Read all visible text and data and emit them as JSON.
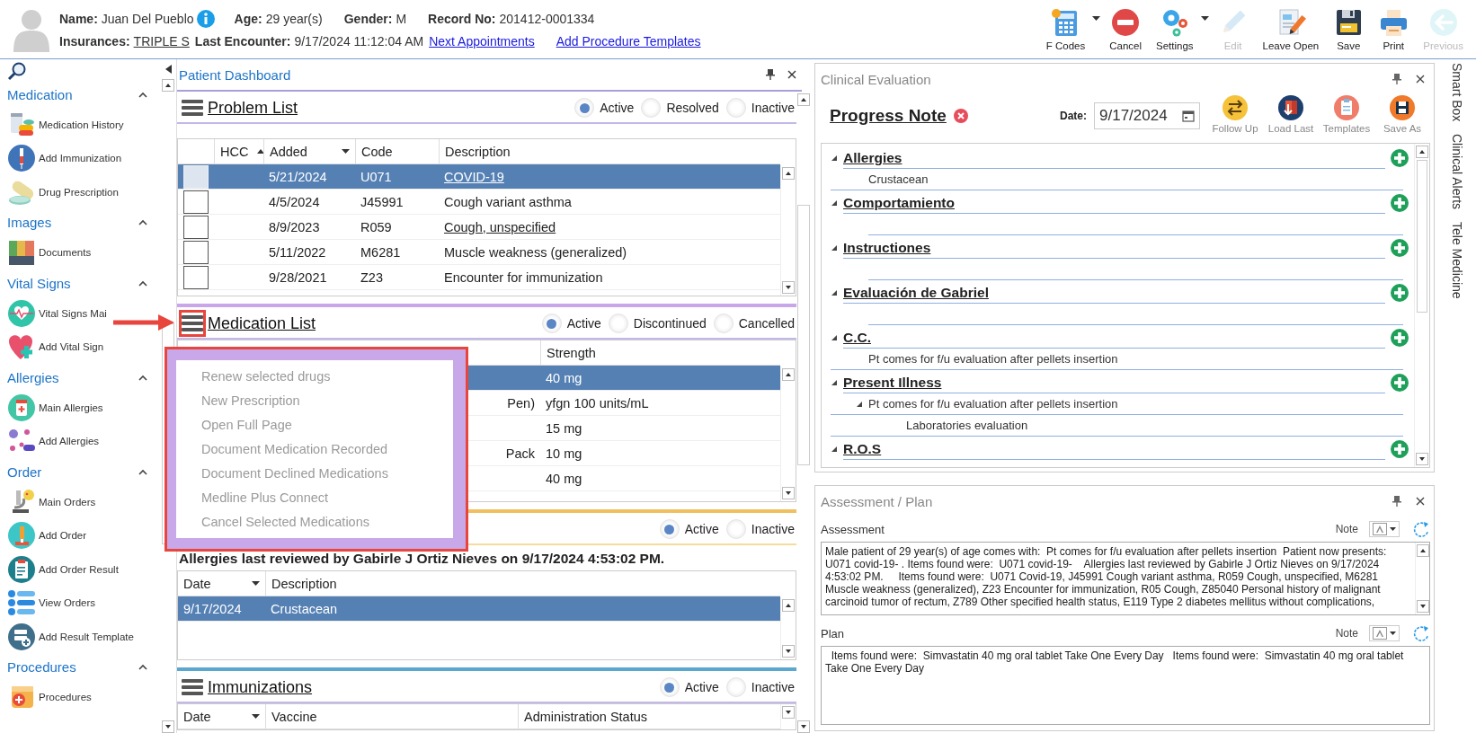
{
  "header": {
    "row_1": [
      {
        "label": "Name:",
        "value": "Juan Del Pueblo",
        "info": true,
        "link": false
      },
      {
        "label": "Age:",
        "value": "29 year(s)",
        "info": false,
        "link": false
      },
      {
        "label": "Gender:",
        "value": "M",
        "info": false,
        "link": false
      },
      {
        "label": "Record No:",
        "value": "201412-0001334",
        "info": false,
        "link": false
      }
    ],
    "row_2": [
      {
        "label": "Insurances:",
        "value": "TRIPLE S",
        "info": false,
        "link": true
      },
      {
        "label": "Last Encounter:",
        "value": "9/17/2024 11:12:04 AM",
        "info": false,
        "link": false
      }
    ],
    "links": [
      "Next Appointments",
      "Add Procedure Templates"
    ],
    "toolbar": [
      {
        "label": "F Codes",
        "dropdown": true,
        "disabled": false
      },
      {
        "label": "Cancel",
        "dropdown": false,
        "disabled": false
      },
      {
        "label": "Settings",
        "dropdown": true,
        "disabled": false
      },
      {
        "label": "Edit",
        "dropdown": false,
        "disabled": true
      },
      {
        "label": "Leave Open",
        "dropdown": false,
        "disabled": false
      },
      {
        "label": "Save",
        "dropdown": false,
        "disabled": false
      },
      {
        "label": "Print",
        "dropdown": false,
        "disabled": false
      },
      {
        "label": "Previous",
        "dropdown": false,
        "disabled": true
      }
    ]
  },
  "sidebar": {
    "groups": [
      {
        "title": "Medication",
        "expanded": true,
        "items": [
          "Medication History",
          "Add Immunization",
          "Drug Prescription"
        ]
      },
      {
        "title": "Images",
        "expanded": true,
        "items": [
          "Documents"
        ]
      },
      {
        "title": "Vital Signs",
        "expanded": true,
        "items": [
          "Vital Signs Mai",
          "Add Vital Sign"
        ]
      },
      {
        "title": "Allergies",
        "expanded": true,
        "items": [
          "Main Allergies",
          "Add Allergies"
        ]
      },
      {
        "title": "Order",
        "expanded": true,
        "items": [
          "Main Orders",
          "Add Order",
          "Add Order Result",
          "View Orders",
          "Add Result Template"
        ]
      },
      {
        "title": "Procedures",
        "expanded": true,
        "items": [
          "Procedures"
        ]
      }
    ]
  },
  "dashboard": {
    "title": "Patient Dashboard",
    "sections": [
      {
        "kind": "problems",
        "title": "Problem List",
        "highlighted": false,
        "filters": [
          {
            "label": "Active",
            "selected": true
          },
          {
            "label": "Resolved",
            "selected": false
          },
          {
            "label": "Inactive",
            "selected": false
          }
        ],
        "table": {
          "columns": [
            "HCC",
            "Added",
            "Code",
            "Description"
          ],
          "rows": [
            {
              "added": "5/21/2024",
              "code": "U071",
              "description": "COVID-19",
              "link": true,
              "checked": false,
              "selected": true
            },
            {
              "added": "4/5/2024",
              "code": "J45991",
              "description": "Cough variant asthma",
              "link": false,
              "checked": false,
              "selected": false
            },
            {
              "added": "8/9/2023",
              "code": "R059",
              "description": "Cough, unspecified",
              "link": true,
              "checked": false,
              "selected": false
            },
            {
              "added": "5/11/2022",
              "code": "M6281",
              "description": "Muscle weakness (generalized)",
              "link": false,
              "checked": false,
              "selected": false
            },
            {
              "added": "9/28/2021",
              "code": "Z23",
              "description": "Encounter for immunization",
              "link": false,
              "checked": false,
              "selected": false
            }
          ]
        }
      },
      {
        "kind": "medications",
        "title": "Medication List",
        "highlighted": true,
        "filters": [
          {
            "label": "Active",
            "selected": true
          },
          {
            "label": "Discontinued",
            "selected": false
          },
          {
            "label": "Cancelled",
            "selected": false
          }
        ],
        "table": {
          "columns": [
            "Strength"
          ],
          "rows": [
            {
              "strength": "40 mg",
              "selected": true
            },
            {
              "name": "Pen)",
              "strength": "yfgn 100 units/mL",
              "selected": false
            },
            {
              "strength": "15 mg",
              "selected": false
            },
            {
              "name": "Pack",
              "strength": "10 mg",
              "selected": false
            },
            {
              "strength": "40 mg",
              "selected": false
            }
          ]
        },
        "menu": [
          {
            "label": "Renew selected drugs",
            "disabled": true
          },
          {
            "label": "New Prescription",
            "disabled": true
          },
          {
            "label": "Open Full Page",
            "disabled": true
          },
          {
            "label": "Document Medication Recorded",
            "disabled": true
          },
          {
            "label": "Document Declined Medications",
            "disabled": true
          },
          {
            "label": "Medline Plus Connect",
            "disabled": true
          },
          {
            "label": "Cancel Selected Medications",
            "disabled": true
          }
        ]
      },
      {
        "kind": "allergies",
        "filters": [
          {
            "label": "Active",
            "selected": true
          },
          {
            "label": "Inactive",
            "selected": false
          }
        ],
        "note": "Allergies last reviewed by Gabirle J Ortiz Nieves on 9/17/2024 4:53:02 PM.",
        "table": {
          "columns": [
            "Date",
            "Description"
          ],
          "rows": [
            {
              "date": "9/17/2024",
              "description": "Crustacean",
              "selected": true
            }
          ]
        }
      },
      {
        "kind": "immunizations",
        "title": "Immunizations",
        "highlighted": false,
        "filters": [
          {
            "label": "Active",
            "selected": true
          },
          {
            "label": "Inactive",
            "selected": false
          }
        ],
        "table": {
          "columns": [
            "Date",
            "Vaccine",
            "Administration Status"
          ]
        }
      }
    ]
  },
  "clinical_evaluation": {
    "title": "Clinical Evaluation",
    "note_title": "Progress Note",
    "date_label": "Date:",
    "date": "9/17/2024",
    "actions": [
      "Follow Up",
      "Load Last",
      "Templates",
      "Save As"
    ],
    "sections": [
      {
        "title": "Allergies",
        "expanded": true,
        "children": [
          {
            "text": "Crustacean"
          }
        ]
      },
      {
        "title": "Comportamiento",
        "expanded": true
      },
      {
        "title": "Instructiones",
        "expanded": true
      },
      {
        "title": "Evaluación de Gabriel",
        "expanded": true
      },
      {
        "title": "C.C.",
        "expanded": true,
        "children": [
          {
            "text": "Pt comes for f/u evaluation after pellets insertion"
          }
        ]
      },
      {
        "title": "Present Illness",
        "expanded": true,
        "children": [
          {
            "text": "Pt comes for f/u evaluation after pellets insertion",
            "expanded": true,
            "children": [
              {
                "text": "Laboratories evaluation"
              }
            ]
          }
        ]
      },
      {
        "title": "R.O.S",
        "expanded": true
      }
    ]
  },
  "assessment_plan": {
    "title": "Assessment / Plan",
    "assessment_label": "Assessment",
    "assessment_note_label": "Note",
    "assessment": "Male patient of 29 year(s) of age comes with:  Pt comes for f/u evaluation after pellets insertion  Patient now presents: U071 covid-19- . Items found were:  U071 covid-19-    Allergies last reviewed by Gabirle J Ortiz Nieves on 9/17/2024 4:53:02 PM.     Items found were:  U071 Covid-19, J45991 Cough variant asthma, R059 Cough, unspecified, M6281 Muscle weakness (generalized), Z23 Encounter for immunization, R05 Cough, Z85040 Personal history of malignant carcinoid tumor of rectum, Z789 Other specified health status, E119 Type 2 diabetes mellitus without complications,",
    "plan_label": "Plan",
    "plan_note_label": "Note",
    "plan": "  Items found were:  Simvastatin 40 mg oral tablet Take One Every Day   Items found were:  Simvastatin 40 mg oral tablet Take One Every Day"
  },
  "side_tabs": [
    "Smart Box",
    "Clinical Alerts",
    "Tele Medicine"
  ]
}
